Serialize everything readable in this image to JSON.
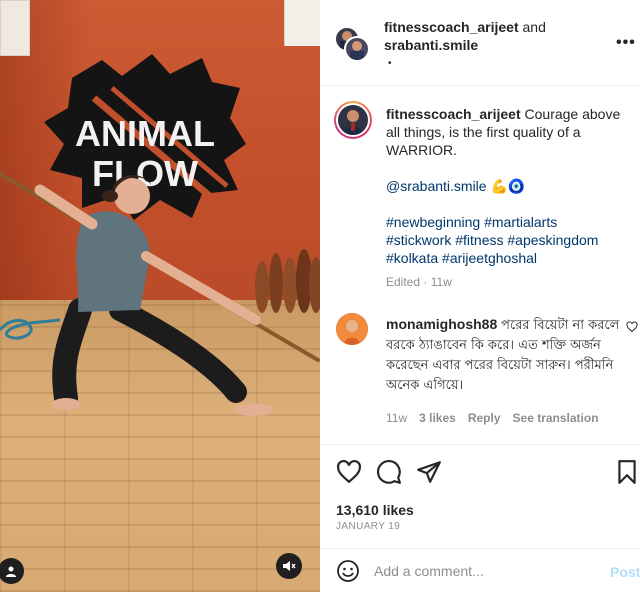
{
  "media": {
    "wall_logo_text_line1": "ANIMAL",
    "wall_logo_text_line2": "FLOW"
  },
  "header": {
    "user1": "fitnesscoach_arijeet",
    "joiner": "and",
    "user2": "srabanti.smile",
    "subline": "•",
    "more_label": "•••"
  },
  "caption": {
    "username": "fitnesscoach_arijeet",
    "text_line1": "Courage above all things, is the first quality of a WARRIOR.",
    "mention": "@srabanti.smile",
    "emojis": "💪🧿",
    "hashtags": [
      "#newbeginning",
      "#martialarts",
      "#stickwork",
      "#fitness",
      "#apeskingdom",
      "#kolkata",
      "#arijeetghoshal"
    ],
    "edited": "Edited",
    "time": "11w"
  },
  "comment": {
    "username": "monamighosh88",
    "text": "পরের বিয়েটা না করলে বরকে ঠ্যাঙাবেন কি করে। এত শক্তি অর্জন করেছেন এবার পরের বিয়েটা সারুন। পরীমনি অনেক এগিয়ে।",
    "time": "11w",
    "likes": "3 likes",
    "reply": "Reply",
    "translate": "See translation"
  },
  "actions": {
    "likes_count": "13,610 likes",
    "date": "JANUARY 19"
  },
  "add_comment": {
    "placeholder": "Add a comment...",
    "post_label": "Post"
  }
}
